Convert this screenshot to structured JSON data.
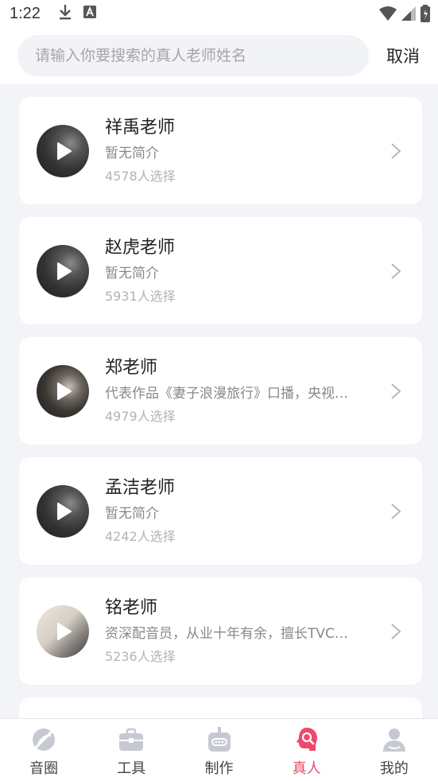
{
  "status_bar": {
    "time": "1:22"
  },
  "search": {
    "placeholder": "请输入你要搜索的真人老师姓名",
    "value": "",
    "cancel_label": "取消"
  },
  "teachers": [
    {
      "name": "祥禹老师",
      "desc": "暂无简介",
      "count": "4578人选择"
    },
    {
      "name": "赵虎老师",
      "desc": "暂无简介",
      "count": "5931人选择"
    },
    {
      "name": "郑老师",
      "desc": "代表作品《妻子浪漫旅行》口播，央视…",
      "count": "4979人选择"
    },
    {
      "name": "孟洁老师",
      "desc": "暂无简介",
      "count": "4242人选择"
    },
    {
      "name": "铭老师",
      "desc": "资深配音员，从业十年有余，擅长TVC…",
      "count": "5236人选择"
    }
  ],
  "bottom_nav": {
    "items": [
      {
        "label": "音圈",
        "icon": "circle-slash-icon"
      },
      {
        "label": "工具",
        "icon": "toolbox-icon"
      },
      {
        "label": "制作",
        "icon": "robot-icon"
      },
      {
        "label": "真人",
        "icon": "person-mic-icon",
        "active": true
      },
      {
        "label": "我的",
        "icon": "profile-icon"
      }
    ]
  },
  "colors": {
    "accent": "#f0486a",
    "background": "#f3f4f8",
    "card": "#ffffff",
    "inactive_icon": "#c7c9d2"
  }
}
